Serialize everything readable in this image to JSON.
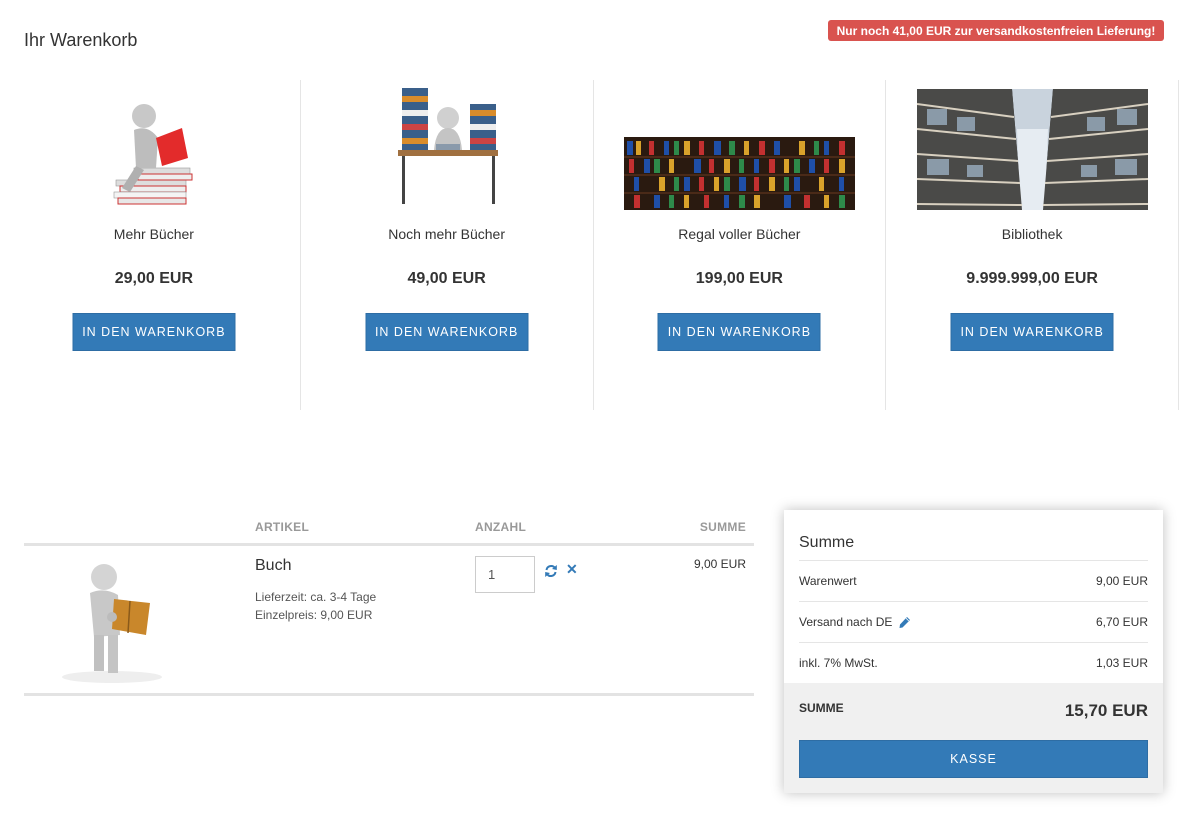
{
  "page": {
    "title": "Ihr Warenkorb"
  },
  "badge": {
    "free_shipping": "Nur noch 41,00 EUR zur versandkostenfreien Lieferung!"
  },
  "products": [
    {
      "name": "Mehr Bücher",
      "price": "29,00 EUR",
      "button": "IN DEN WARENKORB"
    },
    {
      "name": "Noch mehr Bücher",
      "price": "49,00 EUR",
      "button": "IN DEN WARENKORB"
    },
    {
      "name": "Regal voller Bücher",
      "price": "199,00 EUR",
      "button": "IN DEN WARENKORB"
    },
    {
      "name": "Bibliothek",
      "price": "9.999.999,00 EUR",
      "button": "IN DEN WARENKORB"
    }
  ],
  "cart": {
    "headers": {
      "article": "ARTIKEL",
      "quantity": "ANZAHL",
      "sum": "SUMME"
    },
    "items": [
      {
        "title": "Buch",
        "delivery": "Lieferzeit: ca. 3-4 Tage",
        "unit_price": "Einzelpreis: 9,00 EUR",
        "quantity": "1",
        "sum": "9,00 EUR"
      }
    ]
  },
  "summary": {
    "title": "Summe",
    "lines": [
      {
        "label": "Warenwert",
        "value": "9,00 EUR"
      },
      {
        "label": "Versand nach DE",
        "value": "6,70 EUR"
      },
      {
        "label": "inkl. 7% MwSt.",
        "value": "1,03 EUR"
      }
    ],
    "total_label": "SUMME",
    "total_value": "15,70 EUR",
    "checkout_label": "KASSE"
  },
  "colors": {
    "accent": "#337ab7",
    "badge": "#d9534f"
  }
}
